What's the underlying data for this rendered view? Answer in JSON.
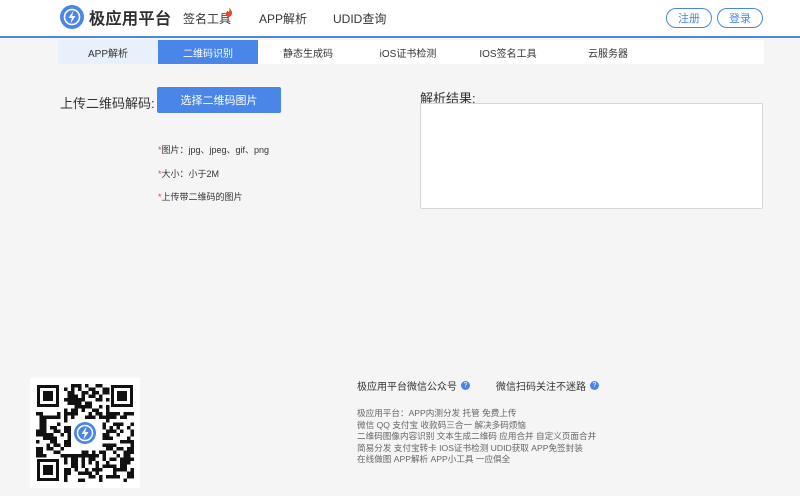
{
  "header": {
    "brand": "极应用平台",
    "nav": [
      {
        "label": "签名工具"
      },
      {
        "label": "APP解析"
      },
      {
        "label": "UDID查询"
      }
    ],
    "register_label": "注册",
    "login_label": "登录"
  },
  "subnav": {
    "tabs": [
      {
        "label": "APP解析"
      },
      {
        "label": "二维码识别"
      },
      {
        "label": "静态生成码"
      },
      {
        "label": "iOS证书检测"
      },
      {
        "label": "IOS签名工具"
      },
      {
        "label": "云服务器"
      }
    ]
  },
  "upload": {
    "label": "上传二维码解码:",
    "button_label": "选择二维码图片",
    "rules": [
      {
        "star": "*",
        "text": "图片：jpg、jpeg、gif、png"
      },
      {
        "star": "*",
        "text": "大小：小于2M"
      },
      {
        "star": "*",
        "text": "上传带二维码的图片"
      }
    ]
  },
  "result": {
    "label": "解析结果:",
    "value": ""
  },
  "footer": {
    "wechat_heading": "极应用平台微信公众号",
    "scan_heading": "微信扫码关注不迷路",
    "help_glyph": "?",
    "links": [
      "极应用平台：APP内测分发 托管 免费上传",
      "微信 QQ 支付宝 收款码三合一 解决多码烦恼",
      "二维码图像内容识别 文本生成二维码 应用合并 自定义页面合并",
      "简易分发 支付宝转卡 IOS证书检测 UDID获取 APP免签封装",
      "在线做图 APP解析 APP小工具 一应俱全"
    ]
  },
  "colors": {
    "accent": "#4a86e8",
    "star": "#e24a2c",
    "hot": "#e8452c"
  }
}
